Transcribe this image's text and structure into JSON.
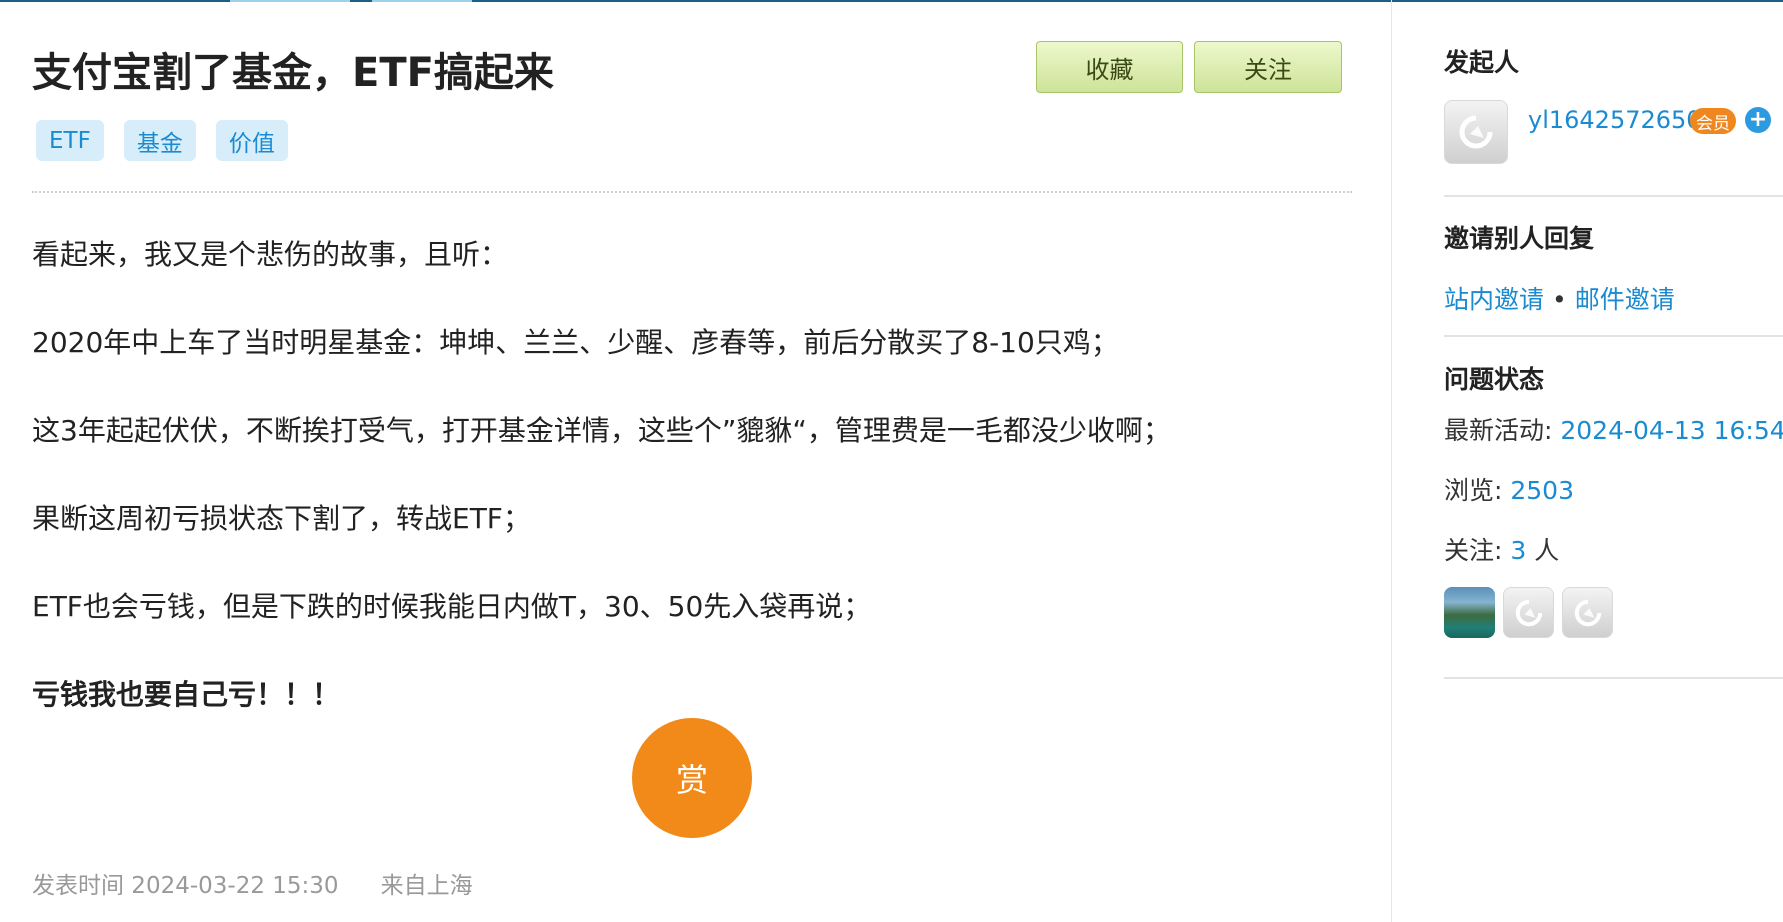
{
  "post": {
    "title": "支付宝割了基金，ETF搞起来",
    "tags": [
      "ETF",
      "基金",
      "价值"
    ],
    "buttons": {
      "favorite": "收藏",
      "follow": "关注"
    },
    "paragraphs": [
      "看起来，我又是个悲伤的故事，且听：",
      "2020年中上车了当时明星基金：坤坤、兰兰、少醒、彦春等，前后分散买了8-10只鸡；",
      "这3年起起伏伏，不断挨打受气，打开基金详情，这些个”貔貅“，管理费是一毛都没少收啊；",
      "果断这周初亏损状态下割了，转战ETF；",
      "ETF也会亏钱，但是下跌的时候我能日内做T，30、50先入袋再说；",
      "亏钱我也要自己亏！！！"
    ],
    "reward_label": "赏",
    "published": "发表时间 2024-03-22 15:30",
    "location": "来自上海"
  },
  "sidebar": {
    "initiator_heading": "发起人",
    "user": {
      "name": "yl1642572650",
      "badge": "会员"
    },
    "invite_heading": "邀请别人回复",
    "invite_site": "站内邀请",
    "invite_dot": "•",
    "invite_email": "邮件邀请",
    "status_heading": "问题状态",
    "latest_label": "最新活动: ",
    "latest_value": "2024-04-13 16:54",
    "views_label": "浏览: ",
    "views_value": "2503",
    "follow_label": "关注: ",
    "follow_value": "3",
    "follow_unit": " 人"
  },
  "colors": {
    "link": "#1a8ad1",
    "tag_bg": "#d7eefa",
    "button_green": "#cde398",
    "reward_orange": "#f28a1a",
    "badge_orange": "#f0871e"
  },
  "icons": {
    "default_avatar": "default-avatar-icon",
    "add_follow": "plus-circle-icon"
  }
}
